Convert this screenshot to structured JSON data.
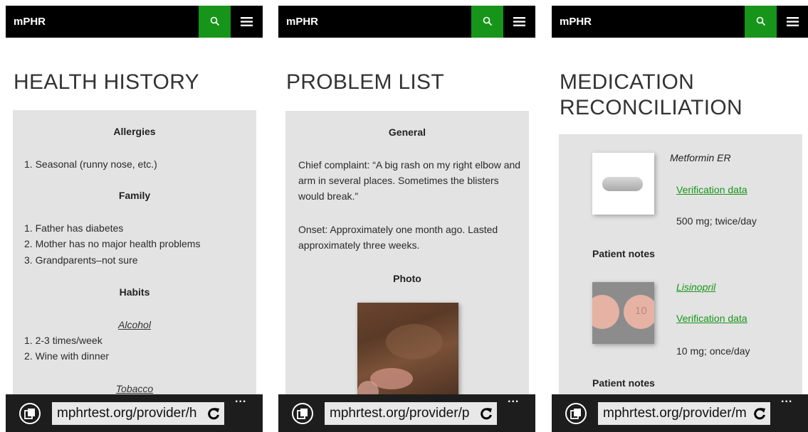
{
  "brand": "mPHR",
  "screens": [
    {
      "title": "HEALTH HISTORY",
      "sections": {
        "allergies": "Allergies",
        "allergy_items": [
          "1. Seasonal (runny nose, etc.)"
        ],
        "family": "Family",
        "family_items": [
          "1. Father has diabetes",
          "2. Mother has no major health problems",
          "3. Grandparents–not sure"
        ],
        "habits": "Habits",
        "alcohol": "Alcohol",
        "alcohol_items": [
          "1. 2-3 times/week",
          "2. Wine with dinner"
        ],
        "tobacco": "Tobacco"
      },
      "url": "mphrtest.org/provider/h"
    },
    {
      "title": "PROBLEM LIST",
      "general": "General",
      "complaint": "Chief complaint: “A big rash on my right elbow and arm in several places. Sometimes the blisters would break.”",
      "onset": "Onset: Approximately  one month ago. Lasted approximately three weeks.",
      "photo_label": "Photo",
      "url": "mphrtest.org/provider/p"
    },
    {
      "title_line1": "MEDICATION",
      "title_line2": "RECONCILIATION",
      "meds": [
        {
          "name": "Metformin ER",
          "verify": "Verification data",
          "dose": "500 mg; twice/day",
          "notes": "Patient notes"
        },
        {
          "name": "Lisinopril",
          "verify": "Verification data",
          "dose": "10 mg; once/day",
          "notes": "Patient notes",
          "pill_text": "10"
        }
      ],
      "url": "mphrtest.org/provider/m"
    }
  ],
  "more_label": "...",
  "colors": {
    "accent": "#17951a",
    "topbar": "#000000",
    "card": "#e3e3e3",
    "browserbar": "#1d1d1d"
  }
}
